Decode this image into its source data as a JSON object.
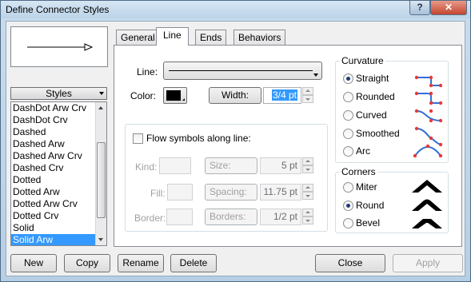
{
  "window": {
    "title": "Define Connector Styles",
    "help": "?",
    "close": "✕"
  },
  "styles": {
    "header": "Styles",
    "items": [
      "DashDot Arw Crv",
      "DashDot Crv",
      "Dashed",
      "Dashed Arw",
      "Dashed Arw Crv",
      "Dashed Crv",
      "Dotted",
      "Dotted Arw",
      "Dotted Arw Crv",
      "Dotted Crv",
      "Solid",
      "Solid Arw"
    ],
    "selected": "Solid Arw"
  },
  "tabs": [
    "General",
    "Line",
    "Ends",
    "Behaviors"
  ],
  "active_tab": "Line",
  "line": {
    "line_label": "Line:",
    "color_label": "Color:",
    "color_value": "#000000",
    "width_label": "Width:",
    "width_value": "3/4 pt"
  },
  "flow": {
    "checkbox_label": "Flow symbols along line:",
    "kind_label": "Kind:",
    "fill_label": "Fill:",
    "border_label": "Border:",
    "size_label": "Size:",
    "size_value": "5 pt",
    "spacing_label": "Spacing:",
    "spacing_value": "11.75 pt",
    "borders_label": "Borders:",
    "borders_value": "1/2 pt"
  },
  "curvature": {
    "title": "Curvature",
    "options": [
      "Straight",
      "Rounded",
      "Curved",
      "Smoothed",
      "Arc"
    ],
    "selected": "Straight"
  },
  "corners": {
    "title": "Corners",
    "options": [
      "Miter",
      "Round",
      "Bevel"
    ],
    "selected": "Round"
  },
  "buttons": {
    "new": "New",
    "copy": "Copy",
    "rename": "Rename",
    "delete": "Delete",
    "close": "Close",
    "apply": "Apply"
  },
  "colors": {
    "selection": "#3399ff",
    "accent_red": "#e83a3a",
    "accent_blue": "#2f6fd6"
  }
}
